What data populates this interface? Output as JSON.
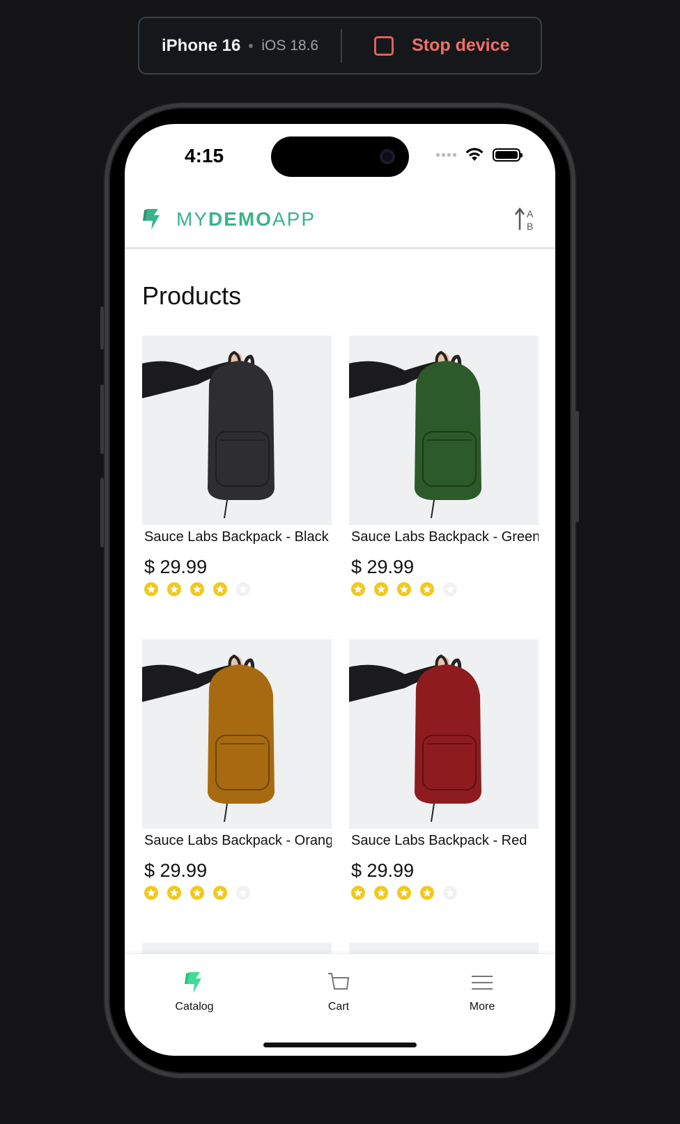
{
  "device_bar": {
    "device_name": "iPhone 16",
    "os_version": "iOS 18.6",
    "stop_label": "Stop device"
  },
  "status_bar": {
    "time": "4:15"
  },
  "app": {
    "brand_prefix": "MY",
    "brand_bold": "DEMO",
    "brand_suffix": "APP",
    "brand_color": "#3ab38b"
  },
  "page": {
    "title": "Products"
  },
  "products": [
    {
      "name": "Sauce Labs Backpack - Black",
      "price": "$ 29.99",
      "rating": 4,
      "color": "#2e2e30"
    },
    {
      "name": "Sauce Labs Backpack - Green",
      "price": "$ 29.99",
      "rating": 4,
      "color": "#2c5a2a"
    },
    {
      "name": "Sauce Labs Backpack - Orange",
      "price": "$ 29.99",
      "rating": 4,
      "color": "#a86a10"
    },
    {
      "name": "Sauce Labs Backpack - Red",
      "price": "$ 29.99",
      "rating": 4,
      "color": "#8e1c1e"
    }
  ],
  "tabs": [
    {
      "label": "Catalog",
      "icon": "logo-icon"
    },
    {
      "label": "Cart",
      "icon": "cart-icon"
    },
    {
      "label": "More",
      "icon": "menu-icon"
    }
  ]
}
